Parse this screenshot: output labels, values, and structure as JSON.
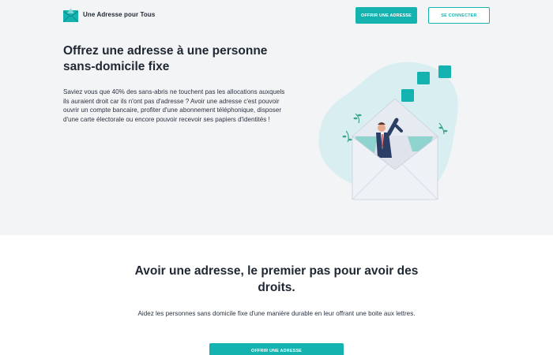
{
  "app": {
    "brand": "Une Adresse pour Tous"
  },
  "nav": {
    "offer_button": "OFFRIR UNE ADRESSE",
    "login_button": "SE CONNECTER"
  },
  "hero": {
    "title": "Offrez une adresse à une personne sans-domicile fixe",
    "text": "Saviez vous que 40% des sans-abris ne touchent pas les allocations auxquels ils auraient droit car ils n'ont pas d'adresse ? Avoir une adresse c'est pouvoir ouvrir un compte bancaire, profiter d'une abonnement téléphonique, disposer d'une carte électorale ou encore pouvoir recevoir ses papiers d'identités !"
  },
  "section": {
    "title": "Avoir une adresse, le premier pas pour avoir des droits.",
    "text": "Aidez les personnes sans domicile fixe d'une manière durable en leur offrant une boite aux lettres.",
    "cta": "OFFRIR UNE ADRESSE"
  },
  "colors": {
    "accent": "#14b3b0",
    "background_light": "#f3f4f6",
    "text_dark": "#1f2733"
  },
  "icons": {
    "logo": "envelope-logo-icon",
    "illustration": "envelope-person-illustration"
  }
}
